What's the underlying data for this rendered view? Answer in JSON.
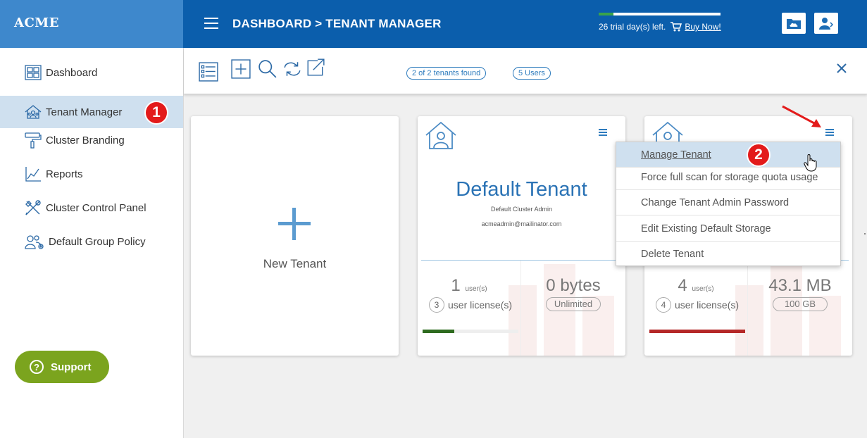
{
  "brand": "ACME",
  "sidebar": {
    "items": [
      {
        "label": "Dashboard",
        "icon": "dashboard-grid-icon"
      },
      {
        "label": "Tenant Manager",
        "icon": "tenant-house-icon",
        "active": true
      },
      {
        "label": "Cluster Branding",
        "icon": "paint-roller-icon"
      },
      {
        "label": "Reports",
        "icon": "line-chart-icon"
      },
      {
        "label": "Cluster Control Panel",
        "icon": "tools-icon"
      },
      {
        "label": "Default Group Policy",
        "icon": "group-gear-icon"
      }
    ],
    "support_label": "Support"
  },
  "annotations": {
    "step1": "1",
    "step2": "2"
  },
  "header": {
    "title": "DASHBOARD > TENANT MANAGER",
    "trial_text": "26 trial day(s) left.",
    "trial_progress": 0.12,
    "buy_label": "Buy Now!"
  },
  "toolbar": {
    "tenants_found": "2 of 2 tenants found",
    "users_count": "5 Users"
  },
  "new_tenant_label": "New Tenant",
  "tenants": [
    {
      "name": "Default Tenant",
      "admin_name": "Default Cluster Admin",
      "admin_email": "acmeadmin@mailinator.com",
      "users": "1",
      "users_unit": "user(s)",
      "licenses": "3",
      "license_label": "user license(s)",
      "storage_used": "0 bytes",
      "storage_quota": "Unlimited",
      "usage_fraction": 0.33,
      "usage_color": "#2e6b1f"
    },
    {
      "users": "4",
      "users_unit": "user(s)",
      "licenses": "4",
      "license_label": "user license(s)",
      "storage_used": "43.1 MB",
      "storage_quota": "100 GB",
      "usage_fraction": 1.0,
      "usage_color": "#b52828"
    }
  ],
  "dropdown": {
    "items": [
      "Manage Tenant",
      "Force full scan for storage quota usage",
      "Change Tenant Admin Password",
      "Edit Existing Default Storage",
      "Delete Tenant"
    ]
  },
  "colors": {
    "header_bg": "#0b5eac",
    "brand_bg": "#3e88cc",
    "accent": "#2b73b5",
    "support_bg": "#7ba41e",
    "annotation_red": "#e31b1b"
  }
}
